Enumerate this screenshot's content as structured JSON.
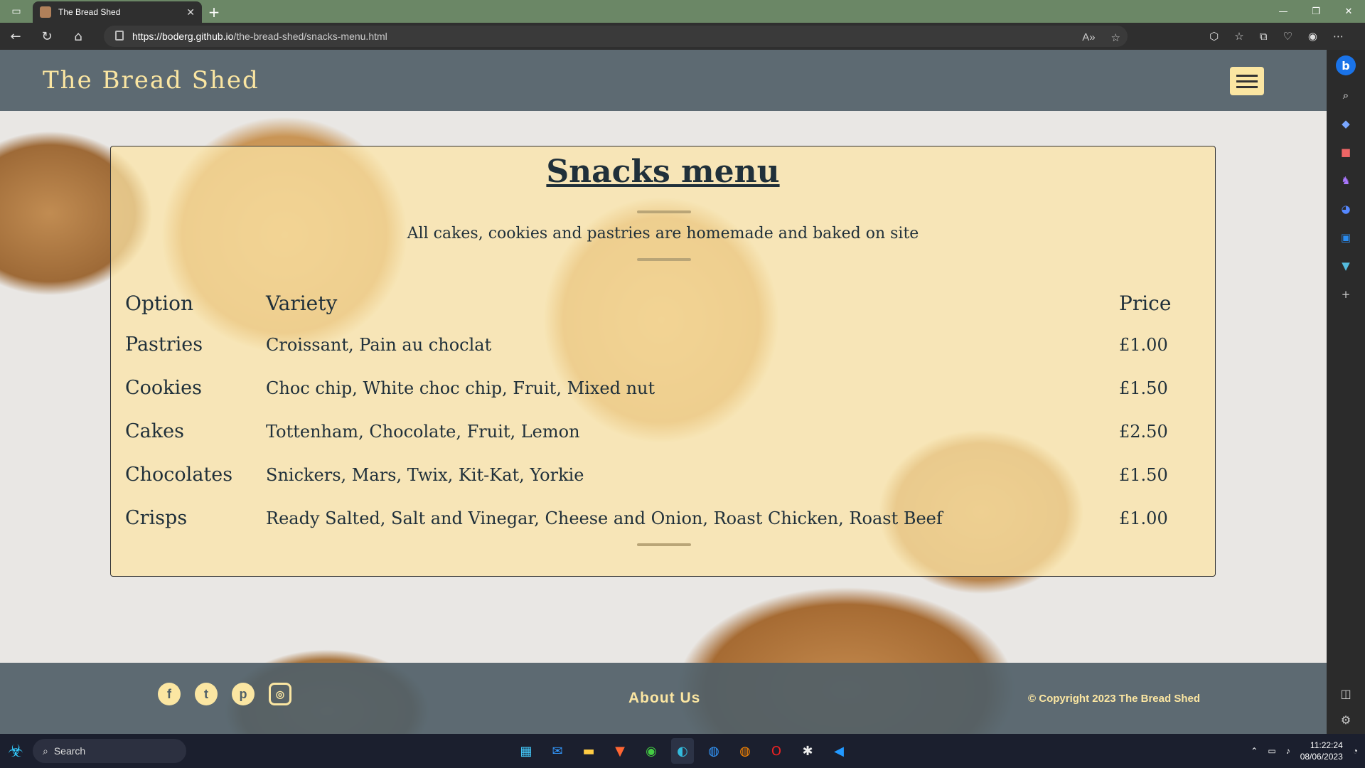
{
  "browser": {
    "tab_title": "The Bread Shed",
    "new_tab": "+",
    "url_domain": "https://boderg.github.io",
    "url_path": "/the-bread-shed/snacks-menu.html"
  },
  "site": {
    "title": "The Bread Shed",
    "menu_heading": "Snacks menu",
    "subtitle": "All cakes, cookies and pastries are homemade and baked on site",
    "table": {
      "headers": [
        "Option",
        "Variety",
        "Price"
      ],
      "rows": [
        {
          "option": "Pastries",
          "variety": "Croissant, Pain au choclat",
          "price": "£1.00"
        },
        {
          "option": "Cookies",
          "variety": "Choc chip, White choc chip, Fruit, Mixed nut",
          "price": "£1.50"
        },
        {
          "option": "Cakes",
          "variety": "Tottenham, Chocolate, Fruit, Lemon",
          "price": "£2.50"
        },
        {
          "option": "Chocolates",
          "variety": "Snickers, Mars, Twix, Kit-Kat, Yorkie",
          "price": "£1.50"
        },
        {
          "option": "Crisps",
          "variety": "Ready Salted, Salt and Vinegar, Cheese and Onion, Roast Chicken, Roast Beef",
          "price": "£1.00"
        }
      ]
    },
    "footer": {
      "about": "About Us",
      "copyright": "© Copyright 2023 The Bread Shed"
    }
  },
  "taskbar": {
    "search_label": "Search",
    "time": "11:22:24",
    "date": "08/06/2023"
  }
}
